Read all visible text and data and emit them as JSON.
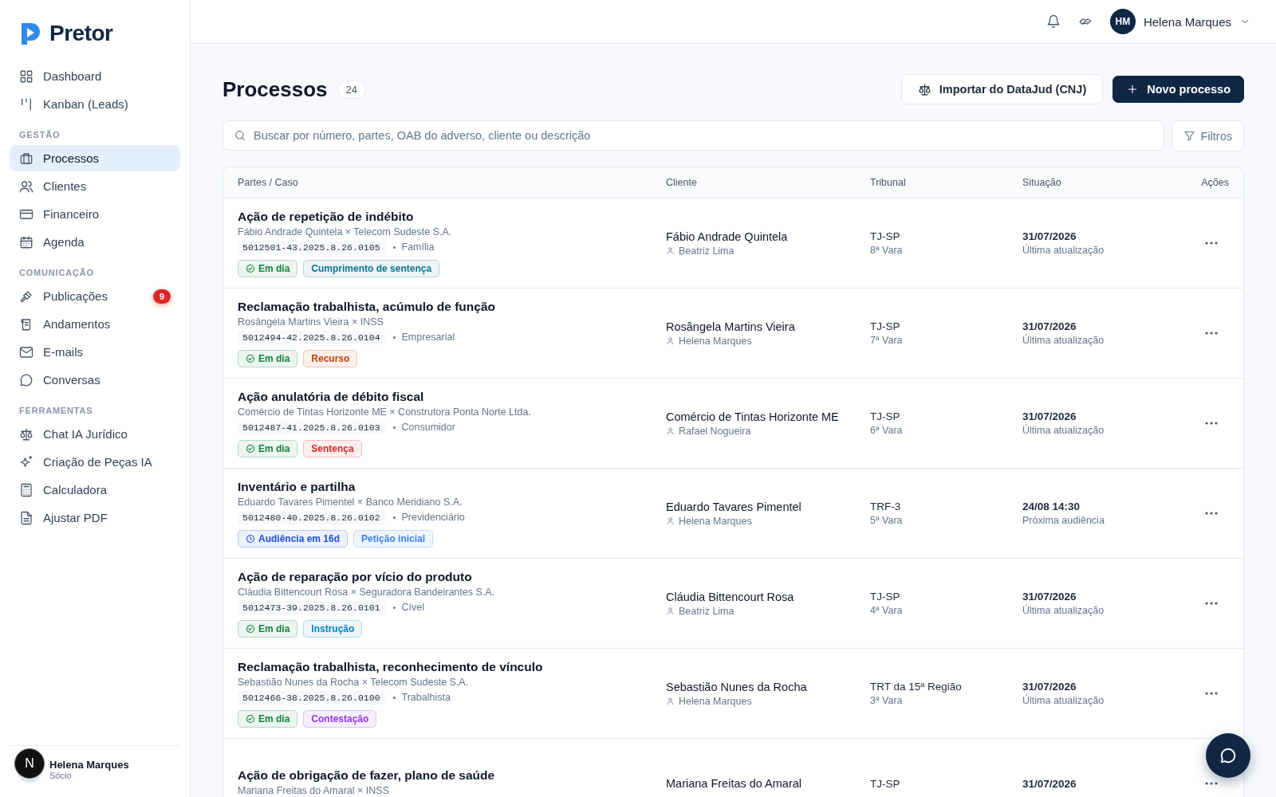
{
  "brand": {
    "name": "Pretor"
  },
  "sidebar": {
    "groups": [
      {
        "items": [
          {
            "label": "Dashboard",
            "selected": false
          },
          {
            "label": "Kanban (Leads)",
            "selected": false
          }
        ]
      },
      {
        "heading": "GESTÃO",
        "items": [
          {
            "label": "Processos",
            "selected": true
          },
          {
            "label": "Clientes",
            "selected": false
          },
          {
            "label": "Financeiro",
            "selected": false
          },
          {
            "label": "Agenda",
            "selected": false
          }
        ]
      },
      {
        "heading": "COMUNICAÇÃO",
        "items": [
          {
            "label": "Publicações",
            "selected": false,
            "badge": "9"
          },
          {
            "label": "Andamentos",
            "selected": false
          },
          {
            "label": "E-mails",
            "selected": false
          },
          {
            "label": "Conversas",
            "selected": false
          }
        ]
      },
      {
        "heading": "FERRAMENTAS",
        "items": [
          {
            "label": "Chat IA Jurídico",
            "selected": false
          },
          {
            "label": "Criação de Peças IA",
            "selected": false
          },
          {
            "label": "Calculadora",
            "selected": false
          },
          {
            "label": "Ajustar PDF",
            "selected": false
          }
        ]
      }
    ],
    "user": {
      "name": "Helena Marques",
      "role": "Sócio"
    }
  },
  "topbar": {
    "user": {
      "initials": "HM",
      "name": "Helena Marques"
    }
  },
  "page": {
    "title": "Processos",
    "count": "24",
    "import_button": "Importar do DataJud (CNJ)",
    "new_button": "Novo processo"
  },
  "search": {
    "placeholder": "Buscar por número, partes, OAB do adverso, cliente ou descrição",
    "filter_button": "Filtros"
  },
  "table": {
    "columns": [
      "Partes / Caso",
      "Cliente",
      "Tribunal",
      "Situação",
      "Ações"
    ],
    "rows": [
      {
        "title": "Ação de repetição de indébito",
        "parties": "Fábio Andrade Quintela × Telecom Sudeste S.A.",
        "number": "5012501-43.2025.8.26.0105",
        "area": "Família",
        "tags": [
          {
            "label": "Em dia",
            "kind": "ontime",
            "color": "#15803d"
          },
          {
            "label": "Cumprimento de sentença",
            "kind": "phase",
            "color": "#0e7490"
          }
        ],
        "client": "Fábio Andrade Quintela",
        "responsible": "Beatriz Lima",
        "tribunal": "TJ-SP",
        "court": "8ª Vara",
        "date": "31/07/2026",
        "date_label": "Última atualização"
      },
      {
        "title": "Reclamação trabalhista, acúmulo de função",
        "parties": "Rosângela Martins Vieira × INSS",
        "number": "5012494-42.2025.8.26.0104",
        "area": "Empresarial",
        "tags": [
          {
            "label": "Em dia",
            "kind": "ontime",
            "color": "#15803d"
          },
          {
            "label": "Recurso",
            "kind": "phase",
            "color": "#c2410c"
          }
        ],
        "client": "Rosângela Martins Vieira",
        "responsible": "Helena Marques",
        "tribunal": "TJ-SP",
        "court": "7ª Vara",
        "date": "31/07/2026",
        "date_label": "Última atualização"
      },
      {
        "title": "Ação anulatória de débito fiscal",
        "parties": "Comércio de Tintas Horizonte ME × Construtora Ponta Norte Ltda.",
        "number": "5012487-41.2025.8.26.0103",
        "area": "Consumidor",
        "tags": [
          {
            "label": "Em dia",
            "kind": "ontime",
            "color": "#15803d"
          },
          {
            "label": "Sentença",
            "kind": "phase",
            "color": "#dc2626"
          }
        ],
        "client": "Comércio de Tintas Horizonte ME",
        "responsible": "Rafael Nogueira",
        "tribunal": "TJ-SP",
        "court": "6ª Vara",
        "date": "31/07/2026",
        "date_label": "Última atualização"
      },
      {
        "title": "Inventário e partilha",
        "parties": "Eduardo Tavares Pimentel × Banco Meridiano S.A.",
        "number": "5012480-40.2025.8.26.0102",
        "area": "Previdenciário",
        "tags": [
          {
            "label": "Audiência em 16d",
            "kind": "hearing",
            "color": "#1d4ed8"
          },
          {
            "label": "Petição inicial",
            "kind": "phase",
            "color": "#3b82f6"
          }
        ],
        "client": "Eduardo Tavares Pimentel",
        "responsible": "Helena Marques",
        "tribunal": "TRF-3",
        "court": "5ª Vara",
        "date": "24/08 14:30",
        "date_label": "Próxima audiência"
      },
      {
        "title": "Ação de reparação por vício do produto",
        "parties": "Cláudia Bittencourt Rosa × Seguradora Bandeirantes S.A.",
        "number": "5012473-39.2025.8.26.0101",
        "area": "Cível",
        "tags": [
          {
            "label": "Em dia",
            "kind": "ontime",
            "color": "#15803d"
          },
          {
            "label": "Instrução",
            "kind": "phase",
            "color": "#0284c7"
          }
        ],
        "client": "Cláudia Bittencourt Rosa",
        "responsible": "Beatriz Lima",
        "tribunal": "TJ-SP",
        "court": "4ª Vara",
        "date": "31/07/2026",
        "date_label": "Última atualização"
      },
      {
        "title": "Reclamação trabalhista, reconhecimento de vínculo",
        "parties": "Sebastião Nunes da Rocha × Telecom Sudeste S.A.",
        "number": "5012466-38.2025.8.26.0100",
        "area": "Trabalhista",
        "tags": [
          {
            "label": "Em dia",
            "kind": "ontime",
            "color": "#15803d"
          },
          {
            "label": "Contestação",
            "kind": "phase",
            "color": "#9333ea"
          }
        ],
        "client": "Sebastião Nunes da Rocha",
        "responsible": "Helena Marques",
        "tribunal": "TRT da 15ª Região",
        "court": "3ª Vara",
        "date": "31/07/2026",
        "date_label": "Última atualização"
      },
      {
        "title": "Ação de obrigação de fazer, plano de saúde",
        "parties": "Mariana Freitas do Amaral × INSS",
        "client": "Mariana Freitas do Amaral",
        "tribunal": "TJ-SP",
        "date": "31/07/2026"
      }
    ]
  },
  "dev_badge": "N"
}
